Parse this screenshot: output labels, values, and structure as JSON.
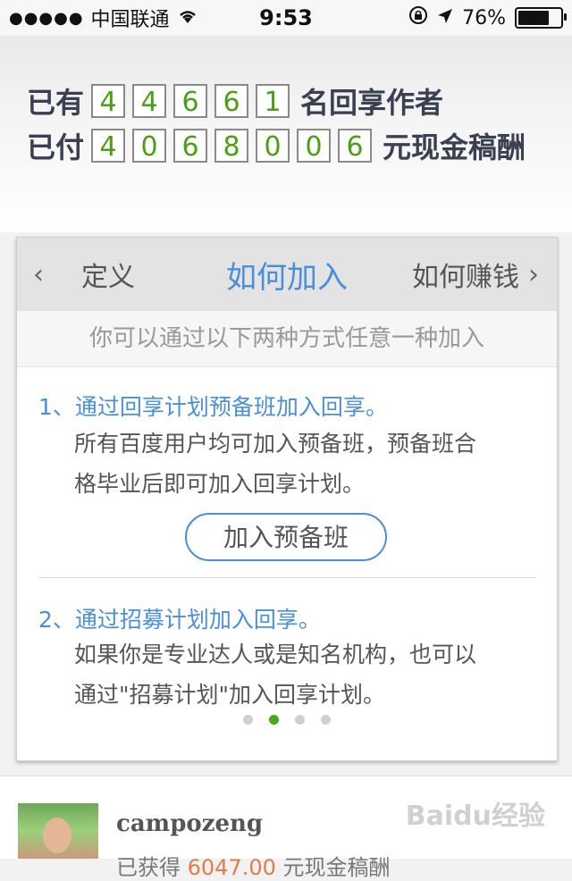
{
  "status_bar": {
    "signal_dots": "●●●●●",
    "carrier": "中国联通",
    "time": "9:53",
    "battery": "76%",
    "icons": [
      "wifi-icon",
      "lock-rotation-icon",
      "location-arrow-icon",
      "battery-icon"
    ]
  },
  "banner": {
    "row1": {
      "prefix": "已有",
      "digits": [
        "4",
        "4",
        "6",
        "6",
        "1"
      ],
      "suffix": "名回享作者"
    },
    "row2": {
      "prefix": "已付",
      "digits": [
        "4",
        "0",
        "6",
        "8",
        "0",
        "0",
        "6"
      ],
      "suffix": "元现金稿酬"
    },
    "digit_color": "#4a9f16"
  },
  "card": {
    "tabs": {
      "left": "定义",
      "center": "如何加入",
      "right": "如何赚钱"
    },
    "subtitle": "你可以通过以下两种方式任意一种加入",
    "step1": {
      "title": "1、通过回享计划预备班加入回享。",
      "desc_line1": "所有百度用户均可加入预备班，预备班合",
      "desc_line2": "格毕业后即可加入回享计划。"
    },
    "join_button": "加入预备班",
    "step2": {
      "title": "2、通过招募计划加入回享。",
      "desc_line1": "如果你是专业达人或是知名机构，也可以",
      "desc_line2": "通过\"招募计划\"加入回享计划。"
    },
    "pager": {
      "count": 4,
      "active": 2
    },
    "accent": "#4a8fd9"
  },
  "user": {
    "name": "campozeng",
    "earned_prefix": "已获得",
    "earned_amount": "6047.00",
    "earned_suffix": "元现金稿酬"
  },
  "watermark": "Baidu经验"
}
